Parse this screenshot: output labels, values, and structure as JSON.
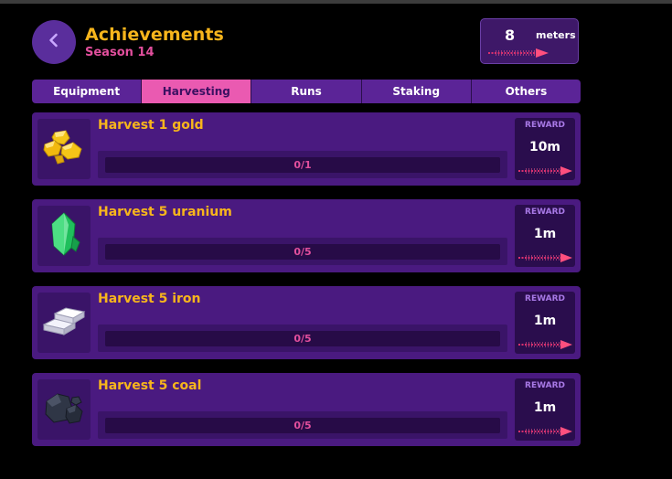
{
  "header": {
    "title": "Achievements",
    "season": "Season 14",
    "meters_value": "8",
    "meters_label": "meters"
  },
  "tabs": [
    {
      "label": "Equipment",
      "active": false
    },
    {
      "label": "Harvesting",
      "active": true
    },
    {
      "label": "Runs",
      "active": false
    },
    {
      "label": "Staking",
      "active": false
    },
    {
      "label": "Others",
      "active": false
    }
  ],
  "achievements": [
    {
      "title": "Harvest 1 gold",
      "icon": "gold-nugget-icon",
      "progress": "0/1",
      "progress_fraction": 0,
      "reward_label": "REWARD",
      "reward_value": "10m"
    },
    {
      "title": "Harvest 5 uranium",
      "icon": "uranium-crystal-icon",
      "progress": "0/5",
      "progress_fraction": 0,
      "reward_label": "REWARD",
      "reward_value": "1m"
    },
    {
      "title": "Harvest 5 iron",
      "icon": "iron-ingot-icon",
      "progress": "0/5",
      "progress_fraction": 0,
      "reward_label": "REWARD",
      "reward_value": "1m"
    },
    {
      "title": "Harvest 5 coal",
      "icon": "coal-lump-icon",
      "progress": "0/5",
      "progress_fraction": 0,
      "reward_label": "REWARD",
      "reward_value": "1m"
    }
  ],
  "colors": {
    "background": "#000000",
    "panel": "#4a1a80",
    "tab": "#5b2497",
    "tab_active": "#ea5ab1",
    "title": "#f7b51c",
    "accent_pink": "#e24f9d",
    "reward_label": "#a879e6"
  }
}
